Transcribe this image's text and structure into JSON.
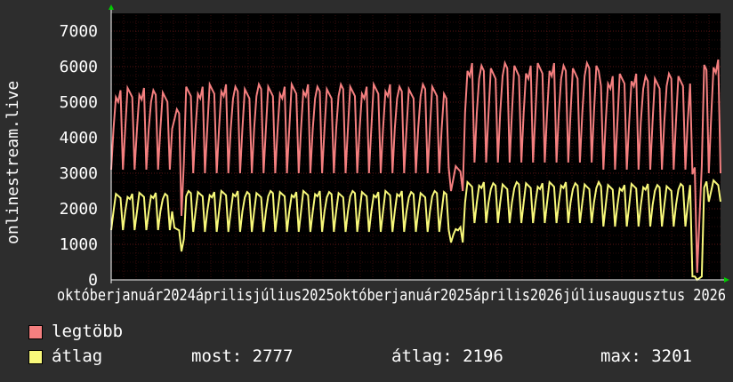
{
  "chart_data": {
    "type": "line",
    "ylabel": "onlinestream.live",
    "ylim": [
      0,
      7500
    ],
    "yticks": [
      "0",
      "1000",
      "2000",
      "3000",
      "4000",
      "5000",
      "6000",
      "7000"
    ],
    "x_tick_labels": [
      "október",
      "2024",
      "január",
      "április",
      "július",
      "2025",
      "október",
      "2025",
      "január",
      "április",
      "július",
      "2026"
    ],
    "x_tick_labels_raw": "októberjanuár2024áprilisjúlius2025októberjanuár2025április2026júliusaugusztus 2026",
    "x_range": [
      "2024-08",
      "2026-10"
    ],
    "grid": true,
    "colors": {
      "background": "#2d2d2d",
      "plot": "#000000",
      "grid": "#5a1515",
      "axis": "#ffffff",
      "legtobb": "#f47f7f",
      "atlag": "#f8f87a",
      "arrow": "#00cc00"
    },
    "series": [
      {
        "name": "legtöbb",
        "color": "#f47f7f",
        "segments": [
          {
            "from": 0.0,
            "to": 0.1,
            "base": 5400,
            "low": 3100,
            "period": 5
          },
          {
            "from": 0.1,
            "to": 0.12,
            "base": 4800,
            "low": 1800,
            "period": 5
          },
          {
            "from": 0.12,
            "to": 0.55,
            "base": 5500,
            "low": 3000,
            "period": 5
          },
          {
            "from": 0.55,
            "to": 0.58,
            "base": 3200,
            "low": 2500,
            "period": 5
          },
          {
            "from": 0.58,
            "to": 0.8,
            "base": 6100,
            "low": 3300,
            "period": 5
          },
          {
            "from": 0.8,
            "to": 0.95,
            "base": 5800,
            "low": 3100,
            "period": 5
          },
          {
            "from": 0.95,
            "to": 0.97,
            "base": 3200,
            "low": 200,
            "period": 5
          },
          {
            "from": 0.97,
            "to": 1.0,
            "base": 6200,
            "low": 3000,
            "period": 5
          }
        ]
      },
      {
        "name": "átlag",
        "color": "#f8f87a",
        "segments": [
          {
            "from": 0.0,
            "to": 0.1,
            "base": 2450,
            "low": 1400,
            "period": 5
          },
          {
            "from": 0.1,
            "to": 0.12,
            "base": 1500,
            "low": 800,
            "period": 5
          },
          {
            "from": 0.12,
            "to": 0.55,
            "base": 2500,
            "low": 1350,
            "period": 5
          },
          {
            "from": 0.55,
            "to": 0.58,
            "base": 1500,
            "low": 1050,
            "period": 5
          },
          {
            "from": 0.58,
            "to": 0.8,
            "base": 2750,
            "low": 1600,
            "period": 5
          },
          {
            "from": 0.8,
            "to": 0.95,
            "base": 2700,
            "low": 1500,
            "period": 5
          },
          {
            "from": 0.95,
            "to": 0.97,
            "base": 100,
            "low": 0,
            "period": 5
          },
          {
            "from": 0.97,
            "to": 1.0,
            "base": 2800,
            "low": 2200,
            "period": 5
          }
        ]
      }
    ]
  },
  "legend": {
    "items": [
      {
        "label": "legtöbb",
        "color": "#f47f7f"
      },
      {
        "label": "átlag",
        "color": "#f8f87a"
      }
    ],
    "stats": {
      "most": "most: 2777",
      "atlag": "átlag: 2196",
      "max": "max: 3201"
    }
  }
}
